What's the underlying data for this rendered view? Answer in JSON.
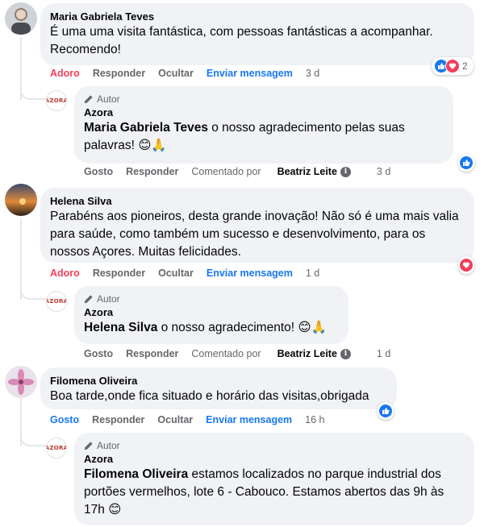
{
  "comments": [
    {
      "author": "Maria Gabriela Teves",
      "text": "É uma uma visita fantástica, com pessoas fantásticas a acompanhar. Recomendo!",
      "actions": {
        "reaction": "Adoro",
        "reply": "Responder",
        "hide": "Ocultar",
        "message": "Enviar mensagem",
        "time": "3 d"
      },
      "reactions_count": "2",
      "reply": {
        "role": "Autor",
        "author": "Azora",
        "logo": "AZORA",
        "mention": "Maria Gabriela Teves",
        "text": " o nosso agradecimento pelas suas palavras! 😊🙏",
        "actions": {
          "like": "Gosto",
          "reply": "Responder",
          "commented_by_label": "Comentado por",
          "commented_by": "Beatriz Leite",
          "time": "3 d"
        }
      }
    },
    {
      "author": "Helena Silva",
      "text": "Parabéns aos pioneiros, desta grande inovação! Não só é uma mais valia para saúde, como também um sucesso e desenvolvimento, para os nossos Açores. Muitas felicidades.",
      "actions": {
        "reaction": "Adoro",
        "reply": "Responder",
        "hide": "Ocultar",
        "message": "Enviar mensagem",
        "time": "1 d"
      },
      "reply": {
        "role": "Autor",
        "author": "Azora",
        "logo": "AZORA",
        "mention": "Helena Silva",
        "text": " o nosso agradecimento! 😊🙏",
        "actions": {
          "like": "Gosto",
          "reply": "Responder",
          "commented_by_label": "Comentado por",
          "commented_by": "Beatriz Leite",
          "time": "1 d"
        }
      }
    },
    {
      "author": "Filomena Oliveira",
      "text": "Boa tarde,onde fica situado e horário das visitas,obrigada",
      "actions": {
        "reaction": "Gosto",
        "reply": "Responder",
        "hide": "Ocultar",
        "message": "Enviar mensagem",
        "time": "16 h"
      },
      "reply": {
        "role": "Autor",
        "author": "Azora",
        "logo": "AZORA",
        "mention": "Filomena Oliveira",
        "text": " estamos localizados no parque industrial dos portões vermelhos, lote 6 - Cabouco. Estamos abertos das 9h às 17h 😊"
      }
    }
  ],
  "colors": {
    "bubble": "#f0f2f5",
    "love": "#f33e58",
    "like": "#1877f2",
    "muted": "#65676b"
  },
  "icons": [
    "like-icon",
    "love-icon",
    "pen-icon",
    "info-icon"
  ]
}
